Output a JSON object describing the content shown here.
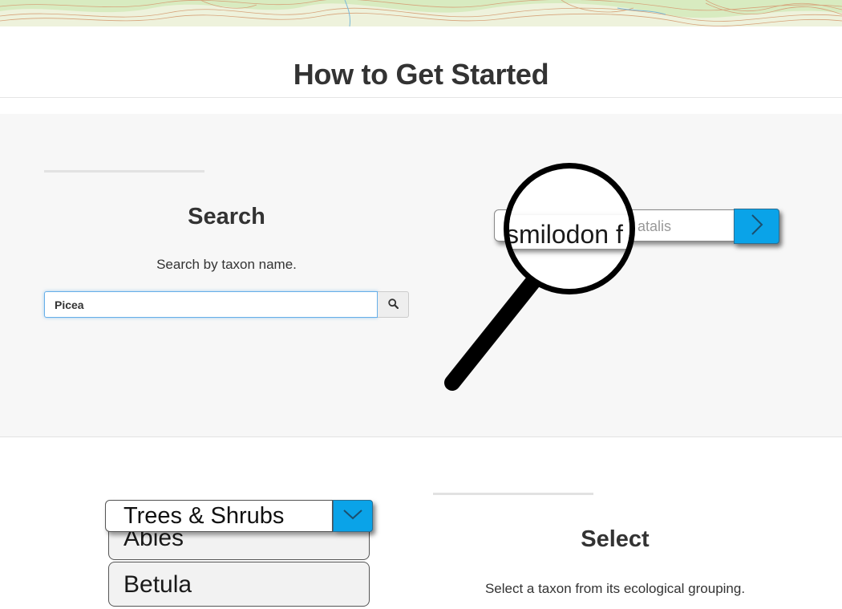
{
  "page": {
    "title": "How to Get Started"
  },
  "search_section": {
    "heading": "Search",
    "description": "Search by taxon name.",
    "input_value": "Picea",
    "button_icon": "search-icon",
    "illustration": {
      "lens_text": "smilodon f",
      "bar_text": "atalis",
      "go_icon": "chevron-right-icon"
    }
  },
  "select_section": {
    "heading": "Select",
    "description": "Select a taxon from its ecological grouping.",
    "illustration": {
      "selected": "Trees & Shrubs",
      "dropdown_icon": "chevron-down-icon",
      "items": [
        "Abies",
        "Betula"
      ]
    }
  },
  "colors": {
    "accent": "#0aa3e8",
    "text": "#333333",
    "section_bg": "#f7f7f7"
  }
}
